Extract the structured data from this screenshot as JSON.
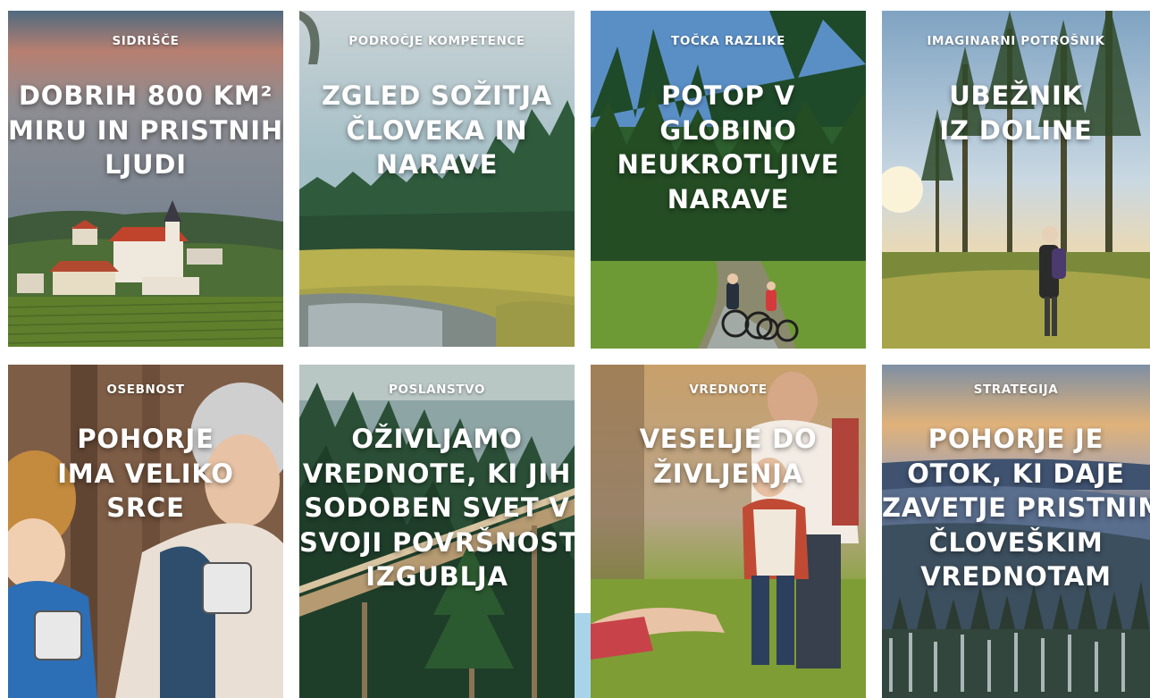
{
  "cards": [
    {
      "label": "SIDRIŠČE",
      "lines": [
        "DOBRIH 800 KM²",
        "MIRU IN PRISTNIH",
        "LJUDI"
      ],
      "scene": "village-church-vineyard"
    },
    {
      "label": "PODROČJE KOMPETENCE",
      "lines": [
        "ZGLED SOŽITJA",
        "ČLOVEKA IN",
        "NARAVE"
      ],
      "scene": "forest-meadow-pond"
    },
    {
      "label": "TOČKA RAZLIKE",
      "lines": [
        "POTOP V",
        "GLOBINO",
        "NEUKROTLJIVE",
        "NARAVE"
      ],
      "scene": "forest-cyclists"
    },
    {
      "label": "IMAGINARNI POTROŠNIK",
      "lines": [
        "UBEŽNIK",
        "IZ DOLINE"
      ],
      "scene": "hiker-forest-sunrise"
    },
    {
      "label": "OSEBNOST",
      "lines": [
        "POHORJE",
        "IMA VELIKO",
        "SRCE"
      ],
      "scene": "grandmother-child-mugs"
    },
    {
      "label": "POSLANSTVO",
      "lines": [
        "OŽIVLJAMO",
        "VREDNOTE, KI JIH",
        "SODOBEN SVET V",
        "SVOJI POVRŠNOSTI",
        "IZGUBLJA"
      ],
      "scene": "treetop-walkway"
    },
    {
      "label": "VREDNOTE",
      "lines": [
        "VESELJE DO",
        "ŽIVLJENJA"
      ],
      "scene": "father-child-meadow"
    },
    {
      "label": "STRATEGIJA",
      "lines": [
        "POHORJE JE",
        "OTOK, KI DAJE",
        "ZAVETJE PRISTNIM",
        "ČLOVEŠKIM",
        "VREDNOTAM"
      ],
      "scene": "snowy-forest-sunset"
    }
  ],
  "colors": {
    "text": "#ffffff",
    "accent_strip": "#a9d3e8"
  }
}
